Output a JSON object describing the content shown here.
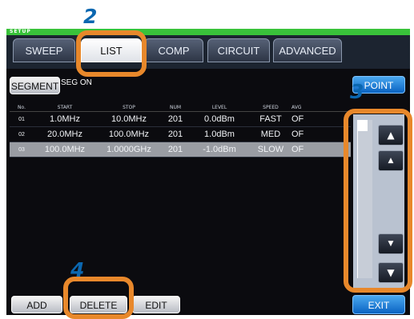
{
  "header": {
    "setup_label": "SETUP"
  },
  "tabs": [
    {
      "label": "SWEEP",
      "active": false
    },
    {
      "label": "LIST",
      "active": true
    },
    {
      "label": "COMP",
      "active": false
    },
    {
      "label": "CIRCUIT",
      "active": false
    },
    {
      "label": "ADVANCED",
      "active": false
    }
  ],
  "segment": {
    "button_label": "SEGMENT",
    "state_text": "SEG ON"
  },
  "point_button": "POINT",
  "table": {
    "columns": [
      "No.",
      "START",
      "STOP",
      "NUM",
      "LEVEL",
      "SPEED",
      "AVG"
    ],
    "rows": [
      {
        "no": "01",
        "start": "1.0MHz",
        "stop": "10.0MHz",
        "num": "201",
        "level": "0.0dBm",
        "speed": "FAST",
        "avg": "OF"
      },
      {
        "no": "02",
        "start": "20.0MHz",
        "stop": "100.0MHz",
        "num": "201",
        "level": "1.0dBm",
        "speed": "MED",
        "avg": "OF"
      },
      {
        "no": "03",
        "start": "100.0MHz",
        "stop": "1.0000GHz",
        "num": "201",
        "level": "-1.0dBm",
        "speed": "SLOW",
        "avg": "OF",
        "selected": true
      }
    ]
  },
  "scroll_buttons": {
    "top": "▲",
    "up": "▲",
    "down": "▼",
    "bottom": "▼"
  },
  "bottom_buttons": {
    "add": "ADD",
    "delete": "DELETE",
    "edit": "EDIT",
    "exit": "EXIT"
  },
  "callouts": {
    "n2": "2",
    "n3": "3",
    "n4": "4"
  },
  "colors": {
    "highlight": "#e8882b",
    "callout_number": "#0b67b0",
    "accent_green": "#39c23a",
    "exit_blue": "#0a63c2"
  }
}
